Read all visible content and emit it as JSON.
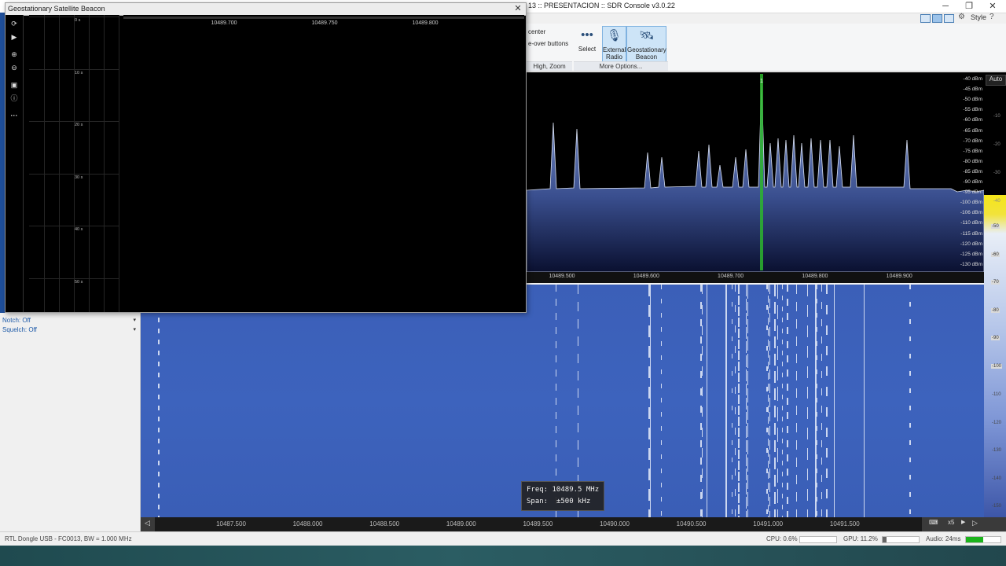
{
  "window": {
    "title": "13 :: PRESENTACION :: SDR Console v3.0.22",
    "minimize": "─",
    "maximize": "❐",
    "close": "✕",
    "style_label": "Style"
  },
  "ribbon": {
    "text_center": "center",
    "text_pushover": "e-over buttons",
    "group_left_label": "High, Zoom",
    "group_more_label": "More Options...",
    "btn_select": "Select",
    "btn_external_line1": "External",
    "btn_external_line2": "Radio",
    "btn_geo_line1": "Geostationary",
    "btn_geo_line2": "Beacon"
  },
  "spectrum": {
    "auto_label": "Auto",
    "marker_label": "1",
    "dbm_labels": [
      "-40 dBm",
      "-45 dBm",
      "-50 dBm",
      "-55 dBm",
      "-60 dBm",
      "-65 dBm",
      "-70 dBm",
      "-75 dBm",
      "-80 dBm",
      "-85 dBm",
      "-90 dBm",
      "-95 dBm",
      "-100 dBm",
      "-106 dBm",
      "-110 dBm",
      "-115 dBm",
      "-120 dBm",
      "-125 dBm",
      "-130 dBm"
    ],
    "axis_ticks": [
      "10489.500",
      "10489.600",
      "10489.700",
      "10489.800",
      "10489.900"
    ],
    "right_ticks": [
      "-10",
      "-20",
      "-30",
      "-40"
    ]
  },
  "waterfall": {
    "scale_labels": [
      "-50",
      "-60",
      "-70",
      "-80",
      "-90",
      "-100"
    ],
    "right_ticks": [
      "-110",
      "-120",
      "-130",
      "-140",
      "-150"
    ],
    "freq_label": "Freq:",
    "freq_value": "10489.5 MHz",
    "span_label": "Span:",
    "span_value": "±500 kHz"
  },
  "bottom_axis": {
    "ticks": [
      "10487.500",
      "10488.000",
      "10488.500",
      "10489.000",
      "10489.500",
      "10490.000",
      "10490.500",
      "10491.000",
      "10491.500"
    ],
    "zoom_label": "x5"
  },
  "left_panel": {
    "notch": "Notch: Off",
    "squelch": "Squelch: Off"
  },
  "statusbar": {
    "device": "RTL Dongle USB - FC0013, BW = 1.000 MHz",
    "cpu": "CPU: 0.6%",
    "gpu": "GPU: 11.2%",
    "audio": "Audio: 24ms",
    "gpu_level": 0.112,
    "audio_level": 0.5
  },
  "beacon": {
    "title": "Geostationary Satellite Beacon",
    "close": "✕",
    "time_labels": [
      "0 s",
      "10 s",
      "20 s",
      "30 s",
      "40 s",
      "50 s"
    ],
    "axis_ticks": [
      "10489.700",
      "10489.750",
      "10489.800"
    ]
  },
  "colors": {
    "waterfall_bg": "#3b5fb8",
    "marker_green": "#2db52d",
    "spectrum_fill": "#8ea3d8"
  }
}
